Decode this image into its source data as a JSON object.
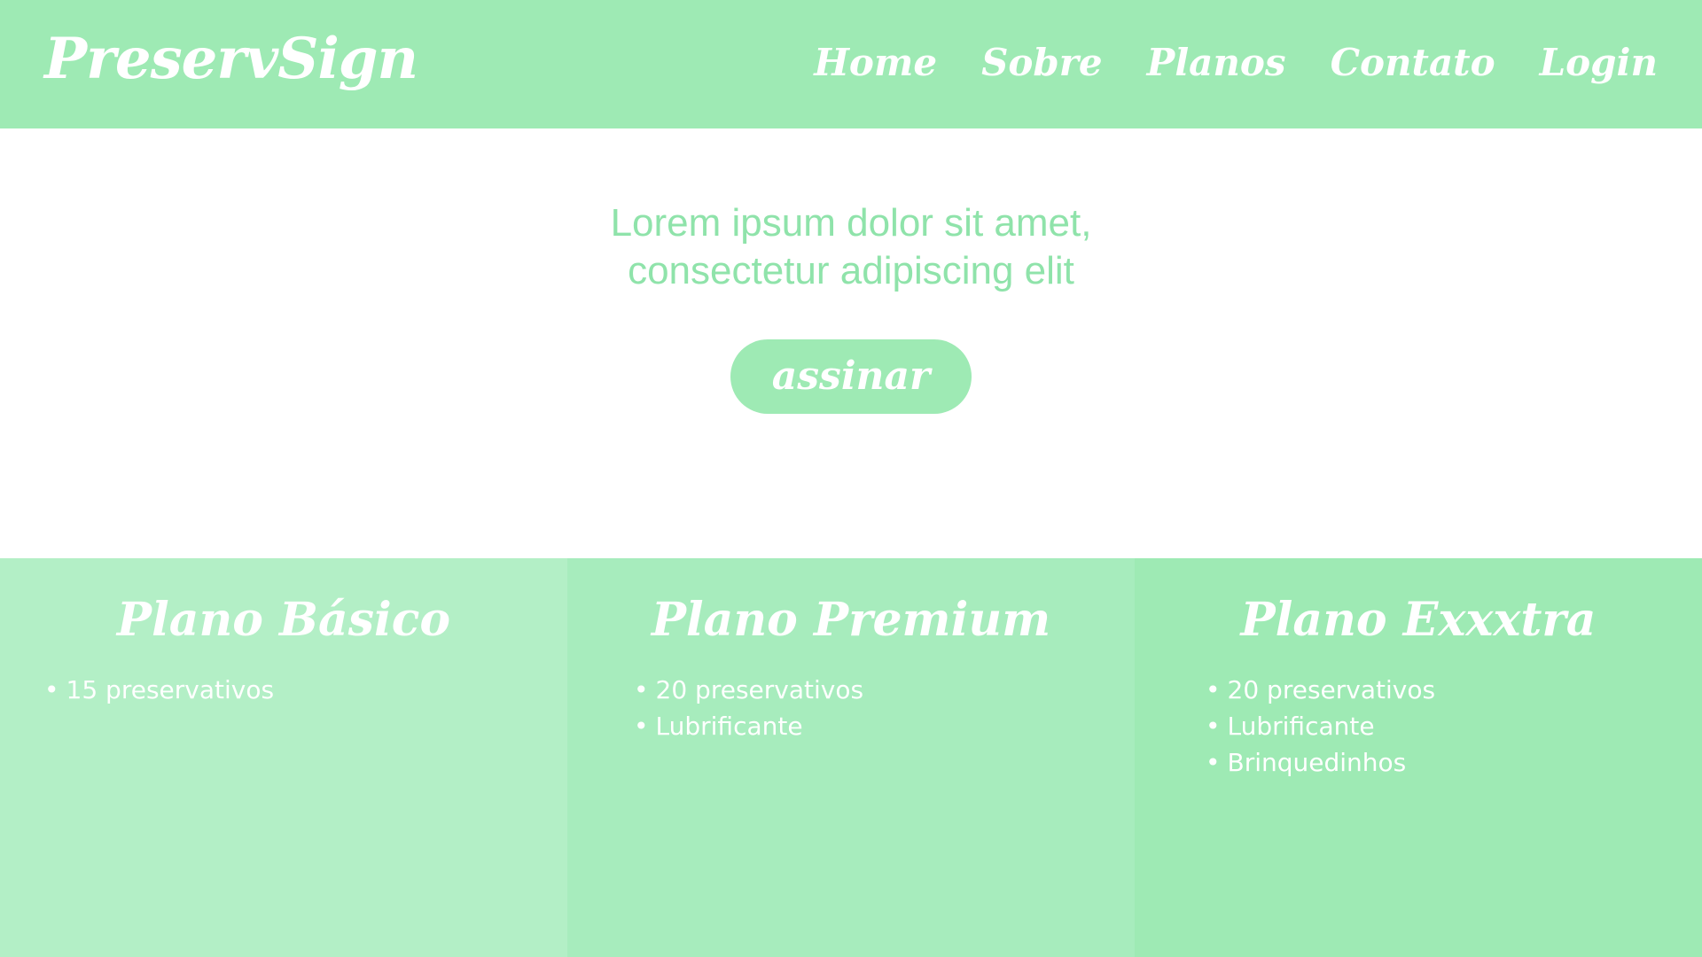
{
  "header": {
    "logo": "PreservSign",
    "nav": [
      "Home",
      "Sobre",
      "Planos",
      "Contato",
      "Login"
    ]
  },
  "hero": {
    "heading_line1": "Lorem ipsum dolor sit amet,",
    "heading_line2": "consectetur adipiscing elit",
    "cta_label": "assinar"
  },
  "plans": [
    {
      "title": "Plano Básico",
      "items": [
        "15 preservativos"
      ]
    },
    {
      "title": "Plano Premium",
      "items": [
        "20 preservativos",
        "Lubrificante"
      ]
    },
    {
      "title": "Plano Exxxtra",
      "items": [
        "20 preservativos",
        "Lubrificante",
        "Brinquedinhos"
      ]
    }
  ],
  "colors": {
    "header_bg": "#9eeab4",
    "plan_basic_bg": "#b3efc6",
    "plan_premium_bg": "#a7ecbd",
    "plan_extra_bg": "#9eeab4",
    "hero_text": "#8fe3aa",
    "button_bg": "#9eeab4"
  }
}
